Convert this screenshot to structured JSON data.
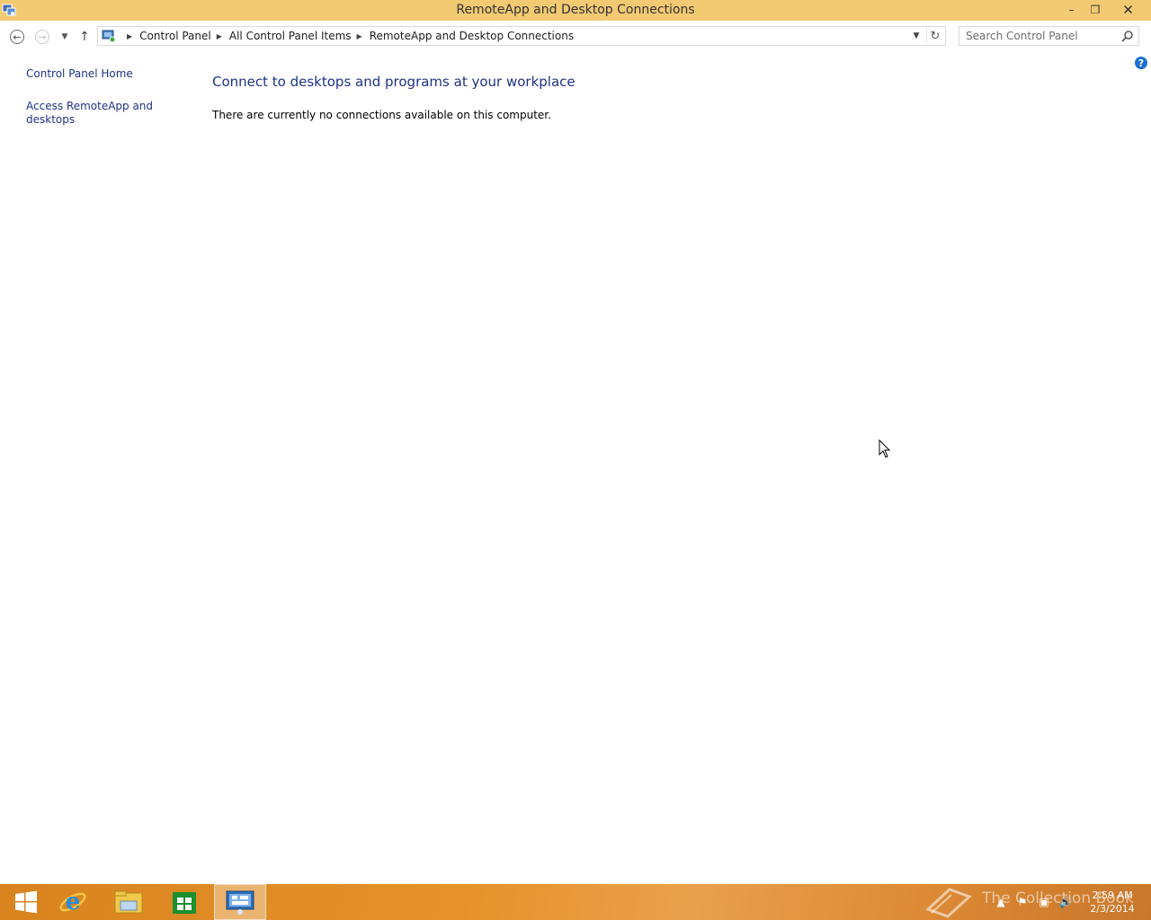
{
  "window": {
    "title": "RemoteApp and Desktop Connections",
    "minimize_glyph": "–",
    "maximize_glyph": "❐",
    "close_glyph": "✕"
  },
  "navigation": {
    "back_icon": "back-arrow-icon",
    "forward_icon": "forward-arrow-icon",
    "recent_icon": "chevron-down-icon",
    "up_icon": "up-arrow-icon",
    "breadcrumbs": [
      "Control Panel",
      "All Control Panel Items",
      "RemoteApp and Desktop Connections"
    ],
    "search_placeholder": "Search Control Panel"
  },
  "left_pane": {
    "home_link": "Control Panel Home",
    "access_link": "Access RemoteApp and desktops"
  },
  "main": {
    "heading": "Connect to desktops and programs at your workplace",
    "message": "There are currently no connections available on this computer."
  },
  "help": {
    "glyph": "?"
  },
  "taskbar": {
    "items": [
      "start-button",
      "internet-explorer",
      "file-explorer",
      "store",
      "control-panel"
    ],
    "active_item": "control-panel",
    "clock_time": "2:59 AM",
    "clock_date": "2/3/2014",
    "watermark": "The Collection Book"
  },
  "colors": {
    "title_bar": "#f3c972",
    "link": "#1e3287",
    "taskbar": "#e6922a",
    "help": "#1a6fd1"
  }
}
